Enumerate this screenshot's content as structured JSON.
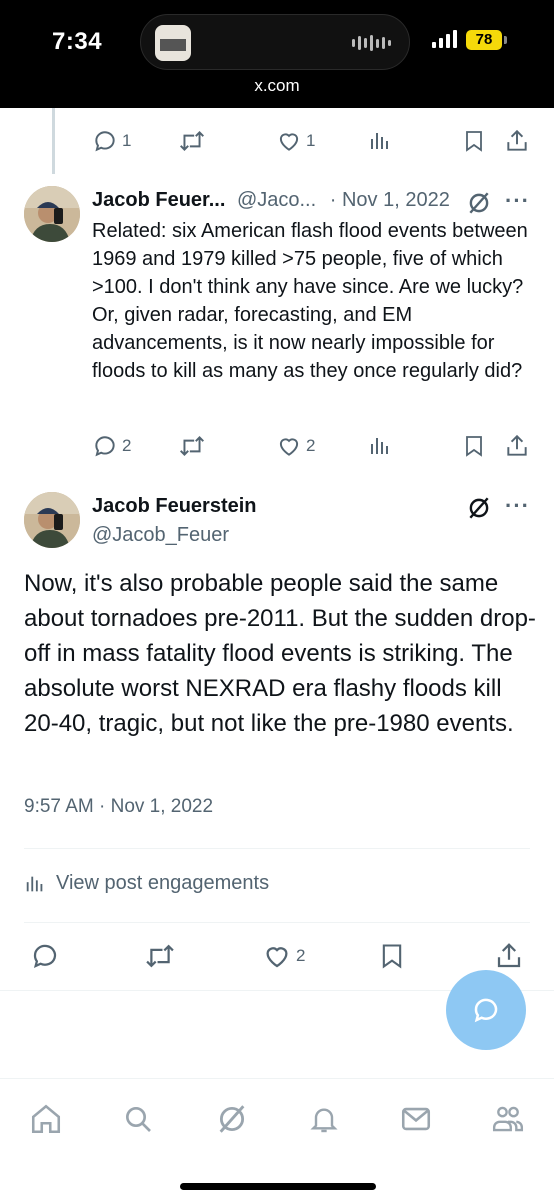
{
  "status_bar": {
    "time": "7:34",
    "url": "x.com",
    "battery": "78"
  },
  "colors": {
    "accent": "#1d9bf0",
    "fab": "#8ec8f3",
    "muted": "#536471",
    "text": "#0f1419",
    "divider": "#eff3f4"
  },
  "top_actions": {
    "replies": "1",
    "reposts": "",
    "likes": "1"
  },
  "reply_tweet": {
    "name": "Jacob Feuer...",
    "handle": "@Jaco...",
    "separator": "·",
    "date": "Nov 1, 2022",
    "text": "Related: six American flash flood events between 1969 and 1979 killed >75 people, five of which >100. I don't think any have since. Are we lucky? Or, given radar, forecasting, and EM advancements, is it now nearly impossible for floods to kill as many as they once regularly did?",
    "replies": "2",
    "likes": "2"
  },
  "main_tweet": {
    "name": "Jacob Feuerstein",
    "handle": "@Jacob_Feuer",
    "text": "Now, it's also probable people said the same about tornadoes pre-2011. But the sudden drop-off in mass fatality flood events is striking. The absolute worst NEXRAD era flashy floods kill 20-40, tragic, but not like the pre-1980 events.",
    "timestamp": "9:57 AM · Nov 1, 2022",
    "engagements_label": "View post engagements",
    "likes": "2"
  },
  "icons": [
    "reply-icon",
    "repost-icon",
    "like-icon",
    "views-icon",
    "bookmark-icon",
    "share-icon",
    "grok-icon",
    "more-icon",
    "home-icon",
    "search-icon",
    "notifications-icon",
    "messages-icon",
    "communities-icon",
    "compose-reply-icon"
  ]
}
